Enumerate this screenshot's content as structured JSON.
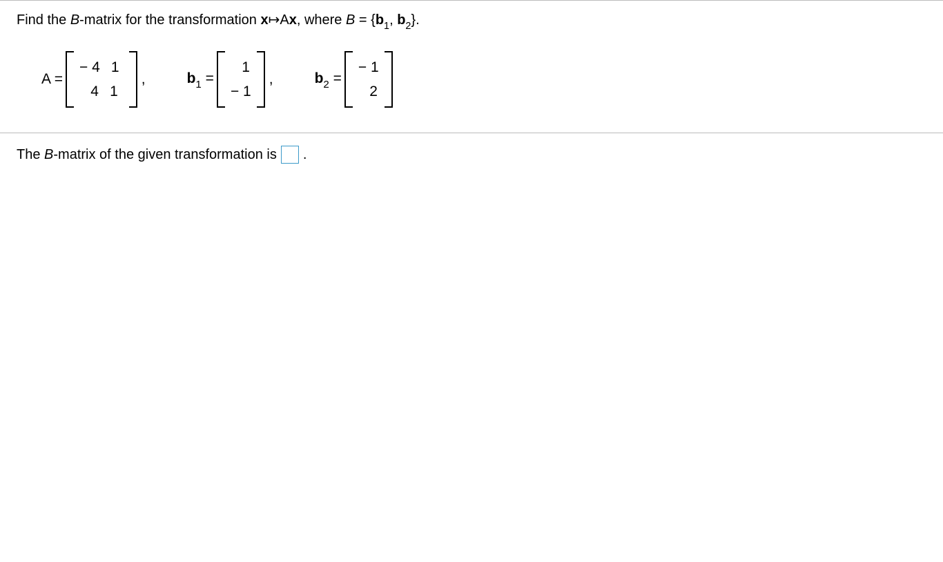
{
  "question": {
    "prefix": "Find the ",
    "B": "B",
    "mid1": "-matrix for the transformation ",
    "x": "x",
    "arrow": "↦",
    "Ax_A": "A",
    "Ax_x": "x",
    "mid2": ", where ",
    "B2": "B",
    "eq": " = {",
    "b": "b",
    "sub1": "1",
    "comma": ", ",
    "sub2": "2",
    "close": "}."
  },
  "matrices": {
    "A": {
      "label_name": "A",
      "label_eq": " =",
      "rows": [
        [
          "− 4",
          "1"
        ],
        [
          "4",
          "1"
        ]
      ]
    },
    "b1": {
      "label_b": "b",
      "label_sub": "1",
      "label_eq": " =",
      "rows": [
        [
          "1"
        ],
        [
          "− 1"
        ]
      ]
    },
    "b2": {
      "label_b": "b",
      "label_sub": "2",
      "label_eq": " =",
      "rows": [
        [
          "− 1"
        ],
        [
          "2"
        ]
      ]
    },
    "comma": ","
  },
  "answer": {
    "prefix": "The ",
    "B": "B",
    "mid": "-matrix of the given transformation is ",
    "period": "."
  }
}
